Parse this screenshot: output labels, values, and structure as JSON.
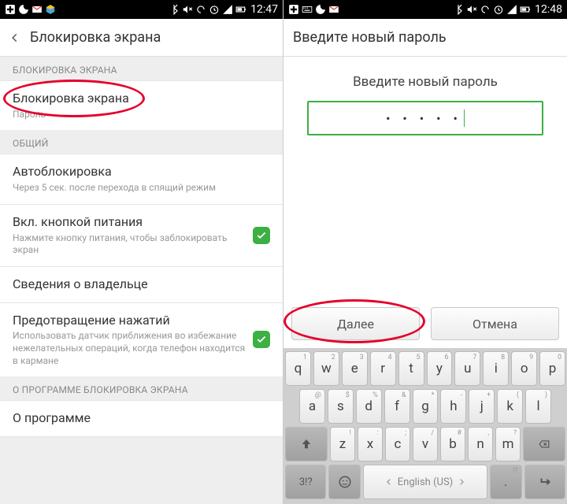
{
  "left": {
    "time": "12:47",
    "title": "Блокировка экрана",
    "sections": {
      "lock": "БЛОКИРОВКА ЭКРАНА",
      "general": "ОБЩИЙ",
      "about": "О ПРОГРАММЕ БЛОКИРОВКА ЭКРАНА"
    },
    "items": {
      "lockScreen": {
        "title": "Блокировка экрана",
        "sub": "Пароль"
      },
      "autoLock": {
        "title": "Автоблокировка",
        "sub": "Через 5 сек. после перехода в спящий режим"
      },
      "powerBtn": {
        "title": "Вкл. кнопкой питания",
        "sub": "Нажмите кнопку питания, чтобы заблокировать экран"
      },
      "owner": {
        "title": "Сведения о владельце"
      },
      "preventTouch": {
        "title": "Предотвращение нажатий",
        "sub": "Использовать датчик приближения во избежание нежелательных операций, когда телефон находится в кармане"
      },
      "aboutItem": {
        "title": "О программе"
      }
    }
  },
  "right": {
    "time": "12:48",
    "title": "Введите новый пароль",
    "prompt": "Введите новый пароль",
    "password": "• • • • •",
    "btnNext": "Далее",
    "btnCancel": "Отмена",
    "spaceLabel": "English (US)"
  },
  "keys": {
    "r1": [
      [
        "q",
        "1"
      ],
      [
        "w",
        "2"
      ],
      [
        "e",
        "3"
      ],
      [
        "r",
        "4"
      ],
      [
        "t",
        "5"
      ],
      [
        "y",
        "6"
      ],
      [
        "u",
        "7"
      ],
      [
        "i",
        "8"
      ],
      [
        "o",
        "9"
      ],
      [
        "p",
        "0"
      ]
    ],
    "r2": [
      [
        "a",
        "@"
      ],
      [
        "s",
        "$"
      ],
      [
        "d",
        "%"
      ],
      [
        "f",
        "&"
      ],
      [
        "g",
        "*"
      ],
      [
        "h",
        "-"
      ],
      [
        "j",
        "+"
      ],
      [
        "k",
        "("
      ],
      [
        "l",
        ")"
      ]
    ],
    "r3": [
      [
        "z",
        "!"
      ],
      [
        "x",
        ":"
      ],
      [
        "c",
        ";"
      ],
      [
        "v",
        "/"
      ],
      [
        "b",
        "#"
      ],
      [
        "n",
        ","
      ],
      [
        "m",
        "?"
      ]
    ]
  }
}
